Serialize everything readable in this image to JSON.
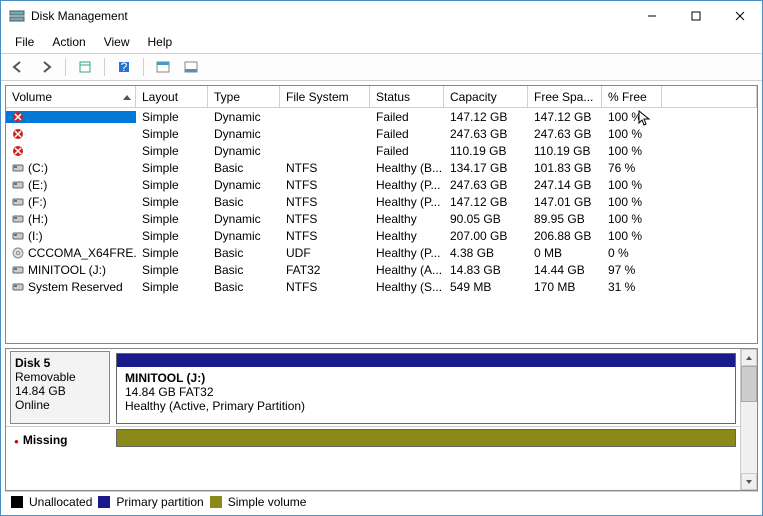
{
  "title": "Disk Management",
  "menu": {
    "file": "File",
    "action": "Action",
    "view": "View",
    "help": "Help"
  },
  "columns": [
    "Volume",
    "Layout",
    "Type",
    "File System",
    "Status",
    "Capacity",
    "Free Spa...",
    "% Free"
  ],
  "rows": [
    {
      "icon": "vol-fail",
      "volume": "",
      "layout": "Simple",
      "type": "Dynamic",
      "fs": "",
      "status": "Failed",
      "capacity": "147.12 GB",
      "free": "147.12 GB",
      "pct": "100 %",
      "selected": true
    },
    {
      "icon": "vol-fail",
      "volume": "",
      "layout": "Simple",
      "type": "Dynamic",
      "fs": "",
      "status": "Failed",
      "capacity": "247.63 GB",
      "free": "247.63 GB",
      "pct": "100 %"
    },
    {
      "icon": "vol-fail",
      "volume": "",
      "layout": "Simple",
      "type": "Dynamic",
      "fs": "",
      "status": "Failed",
      "capacity": "110.19 GB",
      "free": "110.19 GB",
      "pct": "100 %"
    },
    {
      "icon": "drive",
      "volume": "(C:)",
      "layout": "Simple",
      "type": "Basic",
      "fs": "NTFS",
      "status": "Healthy (B...",
      "capacity": "134.17 GB",
      "free": "101.83 GB",
      "pct": "76 %"
    },
    {
      "icon": "drive",
      "volume": "(E:)",
      "layout": "Simple",
      "type": "Dynamic",
      "fs": "NTFS",
      "status": "Healthy (P...",
      "capacity": "247.63 GB",
      "free": "247.14 GB",
      "pct": "100 %"
    },
    {
      "icon": "drive",
      "volume": "(F:)",
      "layout": "Simple",
      "type": "Basic",
      "fs": "NTFS",
      "status": "Healthy (P...",
      "capacity": "147.12 GB",
      "free": "147.01 GB",
      "pct": "100 %"
    },
    {
      "icon": "drive",
      "volume": "(H:)",
      "layout": "Simple",
      "type": "Dynamic",
      "fs": "NTFS",
      "status": "Healthy",
      "capacity": "90.05 GB",
      "free": "89.95 GB",
      "pct": "100 %"
    },
    {
      "icon": "drive",
      "volume": "(I:)",
      "layout": "Simple",
      "type": "Dynamic",
      "fs": "NTFS",
      "status": "Healthy",
      "capacity": "207.00 GB",
      "free": "206.88 GB",
      "pct": "100 %"
    },
    {
      "icon": "disc",
      "volume": "CCCOMA_X64FRE...",
      "layout": "Simple",
      "type": "Basic",
      "fs": "UDF",
      "status": "Healthy (P...",
      "capacity": "4.38 GB",
      "free": "0 MB",
      "pct": "0 %"
    },
    {
      "icon": "drive",
      "volume": "MINITOOL (J:)",
      "layout": "Simple",
      "type": "Basic",
      "fs": "FAT32",
      "status": "Healthy (A...",
      "capacity": "14.83 GB",
      "free": "14.44 GB",
      "pct": "97 %"
    },
    {
      "icon": "drive",
      "volume": "System Reserved",
      "layout": "Simple",
      "type": "Basic",
      "fs": "NTFS",
      "status": "Healthy (S...",
      "capacity": "549 MB",
      "free": "170 MB",
      "pct": "31 %"
    }
  ],
  "disk": {
    "name": "Disk 5",
    "type": "Removable",
    "size": "14.84 GB",
    "state": "Online",
    "vol_name": "MINITOOL  (J:)",
    "vol_info": "14.84 GB FAT32",
    "vol_status": "Healthy (Active, Primary Partition)"
  },
  "missing": {
    "label": "Missing"
  },
  "legend": {
    "unallocated": "Unallocated",
    "primary": "Primary partition",
    "simple": "Simple volume"
  }
}
